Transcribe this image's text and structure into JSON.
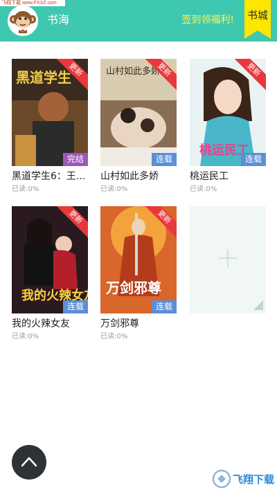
{
  "watermark_top": "飞翔下载 www.FXXZ.com",
  "header": {
    "title": "书海",
    "signin_label": "签到领福利!",
    "store_tab_label": "书城"
  },
  "books": [
    {
      "cover_title": "黑道学生",
      "title": "黑道学生6：王...",
      "read": "已读:0%",
      "status": "完结",
      "status_color": "#9b59b6",
      "ribbon": "更新"
    },
    {
      "cover_title": "山村如此多娇",
      "title": "山村如此多娇",
      "read": "已读:0%",
      "status": "连载",
      "status_color": "#5b8fd6",
      "ribbon": "更新"
    },
    {
      "cover_title": "桃运民工",
      "title": "桃运民工",
      "read": "已读:0%",
      "status": "连载",
      "status_color": "#5b8fd6",
      "ribbon": "更新"
    },
    {
      "cover_title": "我的火辣女友",
      "title": "我的火辣女友",
      "read": "已读:0%",
      "status": "连载",
      "status_color": "#5b8fd6",
      "ribbon": "更新"
    },
    {
      "cover_title": "万剑邪尊",
      "title": "万剑邪尊",
      "read": "已读:0%",
      "status": "连载",
      "status_color": "#5b8fd6",
      "ribbon": "更新"
    }
  ],
  "add_book_icon": "plus-icon",
  "fab_icon": "chevron-up-icon",
  "watermark_bottom": "飞翔下载",
  "colors": {
    "header_bg": "#3ec8b0",
    "signin_text": "#fff35a",
    "store_tab_bg": "#ffe600",
    "ribbon": "#e8383d"
  }
}
